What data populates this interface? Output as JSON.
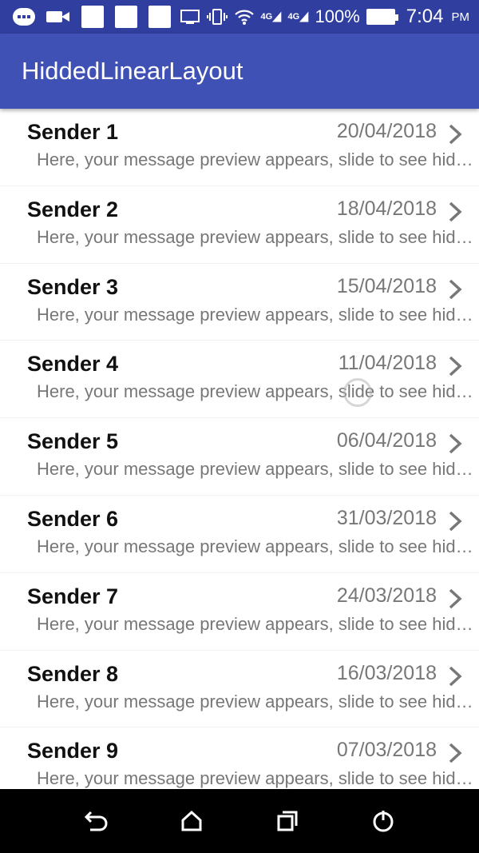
{
  "status_bar": {
    "battery": "100%",
    "time": "7:04",
    "ampm": "PM",
    "signal_labels": [
      "4G",
      "4G"
    ]
  },
  "app_bar": {
    "title": "HiddedLinearLayout"
  },
  "messages": [
    {
      "sender": "Sender 1",
      "date": "20/04/2018",
      "preview": "Here, your message preview appears, slide to see hid…"
    },
    {
      "sender": "Sender 2",
      "date": "18/04/2018",
      "preview": "Here, your message preview appears, slide to see hid…"
    },
    {
      "sender": "Sender 3",
      "date": "15/04/2018",
      "preview": "Here, your message preview appears, slide to see hid…"
    },
    {
      "sender": "Sender 4",
      "date": "11/04/2018",
      "preview": "Here, your message preview appears, slide to see hid…"
    },
    {
      "sender": "Sender 5",
      "date": "06/04/2018",
      "preview": "Here, your message preview appears, slide to see hid…"
    },
    {
      "sender": "Sender 6",
      "date": "31/03/2018",
      "preview": "Here, your message preview appears, slide to see hid…"
    },
    {
      "sender": "Sender 7",
      "date": "24/03/2018",
      "preview": "Here, your message preview appears, slide to see hid…"
    },
    {
      "sender": "Sender 8",
      "date": "16/03/2018",
      "preview": "Here, your message preview appears, slide to see hid…"
    },
    {
      "sender": "Sender 9",
      "date": "07/03/2018",
      "preview": "Here, your message preview appears, slide to see hid…"
    }
  ],
  "colors": {
    "status_bar": "#303f9f",
    "app_bar": "#3f51b5",
    "sender_text": "#111111",
    "secondary_text": "#777777",
    "nav_bar": "#000000"
  },
  "icons": {
    "status_left": [
      "chat-bubble-icon",
      "video-icon",
      "notification-icon",
      "notification-icon",
      "notification-icon"
    ],
    "status_right": [
      "cast-icon",
      "vibrate-icon",
      "wifi-icon",
      "signal-icon",
      "signal-icon",
      "battery-icon"
    ],
    "row": "chevron-right-icon",
    "nav": [
      "back-icon",
      "home-icon",
      "recents-icon",
      "power-icon"
    ]
  }
}
